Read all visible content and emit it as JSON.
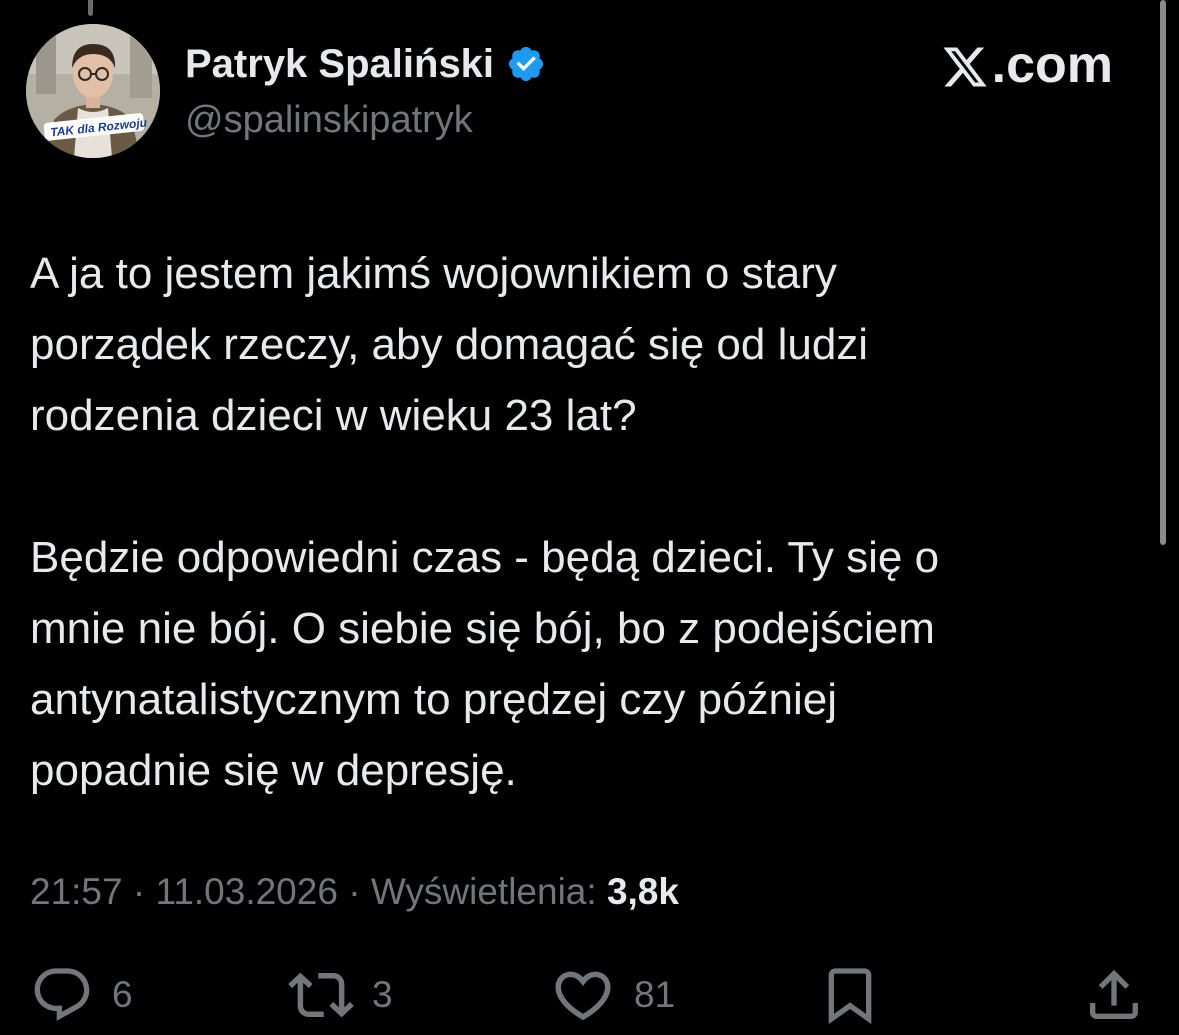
{
  "author": {
    "name": "Patryk Spaliński",
    "handle": "@spalinskipatryk",
    "verified": true,
    "avatar_caption": "TAK dla Rozwoju"
  },
  "brand": {
    "text": ".com",
    "logo_icon": "x-logo-icon"
  },
  "tweet": {
    "paragraphs": [
      {
        "lines": [
          "A ja to jestem jakimś wojownikiem o stary",
          "porządek rzeczy, aby domagać się od ludzi",
          "rodzenia dzieci w wieku 23 lat?"
        ]
      },
      {
        "lines": [
          "Będzie odpowiedni czas - będą dzieci. Ty się o",
          "mnie nie bój. O siebie się bój, bo z podejściem",
          "antynatalistycznym to prędzej czy później",
          "popadnie się w depresję."
        ]
      }
    ]
  },
  "meta": {
    "time": "21:57",
    "separator": " · ",
    "date": "11.03.2026",
    "views_label": "Wyświetlenia:",
    "views_count": "3,8k"
  },
  "actions": {
    "reply": {
      "icon": "reply-icon",
      "count": "6"
    },
    "repost": {
      "icon": "repost-icon",
      "count": "3"
    },
    "like": {
      "icon": "heart-icon",
      "count": "81"
    },
    "bookmark": {
      "icon": "bookmark-icon"
    },
    "share": {
      "icon": "share-icon"
    }
  },
  "colors": {
    "background": "#000000",
    "text_primary": "#e7e9ea",
    "text_secondary": "#71767b",
    "verified_blue": "#1d9bf0"
  }
}
